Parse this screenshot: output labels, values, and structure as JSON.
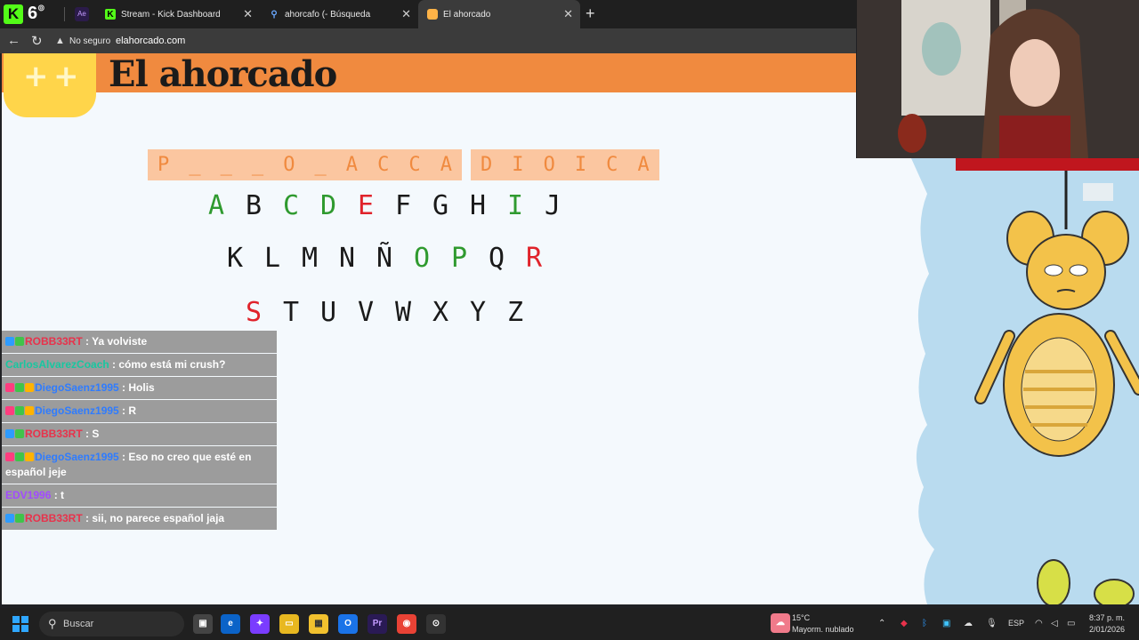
{
  "browser": {
    "kick_count": "6",
    "tabs": [
      {
        "label": "Stream - Kick Dashboard"
      },
      {
        "label": "ahorcafo (- Búsqueda"
      },
      {
        "label": "El ahorcado"
      }
    ],
    "security_label": "No seguro",
    "url": "elahorcado.com"
  },
  "page": {
    "title": "El ahorcado",
    "word_group_1": [
      "P",
      "_",
      "_",
      "_",
      "O",
      "_",
      "A",
      "C",
      "C",
      "A"
    ],
    "word_group_2": [
      "D",
      "I",
      "O",
      "I",
      "C",
      "A"
    ],
    "letters": [
      [
        {
          "ch": "A",
          "state": "ok"
        },
        {
          "ch": "B",
          "state": ""
        },
        {
          "ch": "C",
          "state": "ok"
        },
        {
          "ch": "D",
          "state": "ok"
        },
        {
          "ch": "E",
          "state": "bad"
        },
        {
          "ch": "F",
          "state": ""
        },
        {
          "ch": "G",
          "state": ""
        },
        {
          "ch": "H",
          "state": ""
        },
        {
          "ch": "I",
          "state": "ok"
        },
        {
          "ch": "J",
          "state": ""
        }
      ],
      [
        {
          "ch": "K",
          "state": ""
        },
        {
          "ch": "L",
          "state": ""
        },
        {
          "ch": "M",
          "state": ""
        },
        {
          "ch": "N",
          "state": ""
        },
        {
          "ch": "Ñ",
          "state": ""
        },
        {
          "ch": "O",
          "state": "ok"
        },
        {
          "ch": "P",
          "state": "ok"
        },
        {
          "ch": "Q",
          "state": ""
        },
        {
          "ch": "R",
          "state": "bad"
        }
      ],
      [
        {
          "ch": "S",
          "state": "bad"
        },
        {
          "ch": "T",
          "state": ""
        },
        {
          "ch": "U",
          "state": ""
        },
        {
          "ch": "V",
          "state": ""
        },
        {
          "ch": "W",
          "state": ""
        },
        {
          "ch": "X",
          "state": ""
        },
        {
          "ch": "Y",
          "state": ""
        },
        {
          "ch": "Z",
          "state": ""
        }
      ]
    ],
    "colors": {
      "ok": "#2f9a2f",
      "bad": "#e0232b"
    }
  },
  "chat": [
    {
      "user": "ROBB33RT",
      "color": "#e8324b",
      "text": ": Ya volviste",
      "badges": [
        "#2e9bff",
        "#3fc44a"
      ]
    },
    {
      "user": "CarlosAlvarezCoach",
      "color": "#17c7a0",
      "text": ": cómo está mi crush?",
      "badges": []
    },
    {
      "user": "DiegoSaenz1995",
      "color": "#2f7cff",
      "text": ": Holis",
      "badges": [
        "#ff3d7f",
        "#3fc44a",
        "#ffb300"
      ]
    },
    {
      "user": "DiegoSaenz1995",
      "color": "#2f7cff",
      "text": ": R",
      "badges": [
        "#ff3d7f",
        "#3fc44a",
        "#ffb300"
      ]
    },
    {
      "user": "ROBB33RT",
      "color": "#e8324b",
      "text": ": S",
      "badges": [
        "#2e9bff",
        "#3fc44a"
      ]
    },
    {
      "user": "DiegoSaenz1995",
      "color": "#2f7cff",
      "text": ": Eso no creo que esté en español jeje",
      "badges": [
        "#ff3d7f",
        "#3fc44a",
        "#ffb300"
      ]
    },
    {
      "user": "EDV1996",
      "color": "#a24bff",
      "text": ": t",
      "badges": []
    },
    {
      "user": "ROBB33RT",
      "color": "#e8324b",
      "text": ": sii, no parece español jaja",
      "badges": [
        "#2e9bff",
        "#3fc44a"
      ]
    }
  ],
  "taskbar": {
    "search_label": "Buscar",
    "weather_temp": "15°C",
    "weather_desc": "Mayorm. nublado",
    "lang": "ESP",
    "time": "8:37 p. m.",
    "date": "2/01/2026"
  }
}
